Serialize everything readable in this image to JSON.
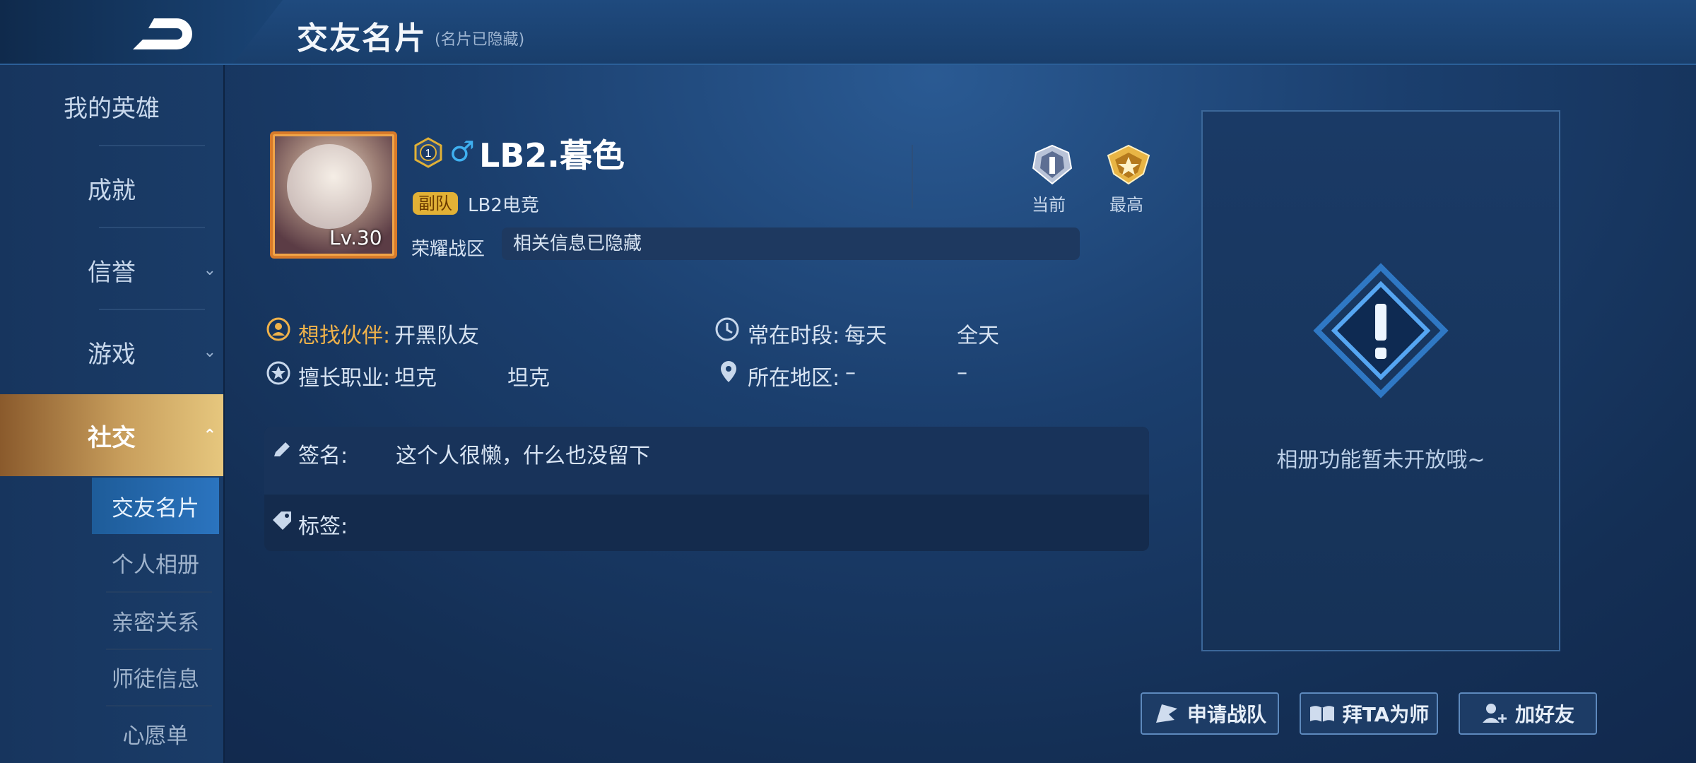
{
  "header": {
    "title": "交友名片",
    "subtitle": "(名片已隐藏)"
  },
  "sidebar": {
    "items": [
      {
        "label": "我的英雄",
        "chevron": ""
      },
      {
        "label": "成就",
        "chevron": ""
      },
      {
        "label": "信誉",
        "chevron": "⌄"
      },
      {
        "label": "游戏",
        "chevron": "⌄"
      },
      {
        "label": "社交",
        "chevron": "⌃"
      }
    ],
    "sub_items": [
      {
        "label": "交友名片"
      },
      {
        "label": "个人相册"
      },
      {
        "label": "亲密关系"
      },
      {
        "label": "师徒信息"
      },
      {
        "label": "心愿单"
      }
    ]
  },
  "profile": {
    "level": "Lv.30",
    "rank_badge_number": "1",
    "gender_symbol": "♂",
    "name": "LB2.暮色",
    "team_role": "副队",
    "team_name": "LB2电竞",
    "honor_label": "荣耀战区",
    "honor_value": "相关信息已隐藏",
    "rank_current_label": "当前",
    "rank_max_label": "最高"
  },
  "info": {
    "partner_label": "想找伙伴:",
    "partner_value": "开黑队友",
    "time_label": "常在时段:",
    "time_value1": "每天",
    "time_value2": "全天",
    "role_label": "擅长职业:",
    "role_value1": "坦克",
    "role_value2": "坦克",
    "region_label": "所在地区:",
    "region_value1": "–",
    "region_value2": "–"
  },
  "signature": {
    "sig_label": "签名:",
    "sig_value": "这个人很懒，什么也没留下",
    "tag_label": "标签:"
  },
  "album": {
    "message": "相册功能暂未开放哦~"
  },
  "actions": {
    "apply_team": "申请战队",
    "mentor": "拜TA为师",
    "add_friend": "加好友"
  },
  "colors": {
    "accent_gold": "#e6c77e",
    "orange_label": "#f0b24a",
    "active_sub": "#2b74bf"
  }
}
